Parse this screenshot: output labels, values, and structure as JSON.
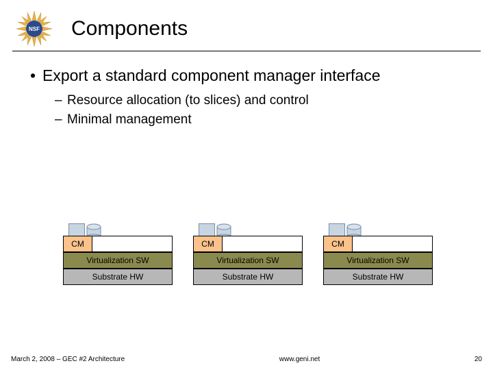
{
  "title": "Components",
  "bullets": {
    "main": "Export a standard component manager interface",
    "sub1": "Resource allocation (to slices) and control",
    "sub2": "Minimal management"
  },
  "stack": {
    "cm": "CM",
    "virt": "Virtualization SW",
    "sub": "Substrate HW"
  },
  "footer": {
    "left": "March 2, 2008 – GEC #2 Architecture",
    "center": "www.geni.net",
    "right": "20"
  },
  "logo_label": "NSF"
}
